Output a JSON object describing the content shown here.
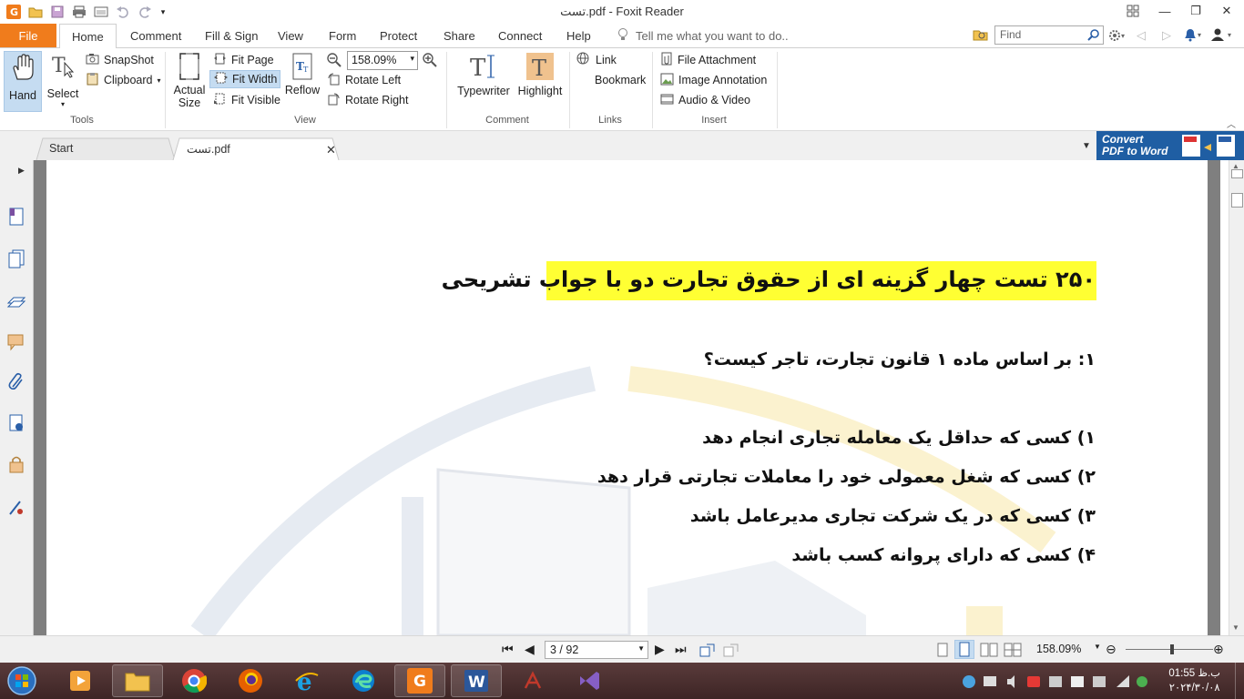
{
  "window": {
    "title": ".تست.pdf - Foxit Reader",
    "title_display": "تست.pdf - Foxit Reader"
  },
  "menu": {
    "file": "File",
    "tabs": [
      "Home",
      "Comment",
      "Fill & Sign",
      "View",
      "Form",
      "Protect",
      "Share",
      "Connect",
      "Help"
    ],
    "tell_me": "Tell me what you want to do..",
    "find_placeholder": "Find"
  },
  "ribbon": {
    "tools": {
      "hand": "Hand",
      "select": "Select",
      "snapshot": "SnapShot",
      "clipboard": "Clipboard",
      "label": "Tools"
    },
    "view": {
      "actual_size_1": "Actual",
      "actual_size_2": "Size",
      "fit_page": "Fit Page",
      "fit_width": "Fit Width",
      "fit_visible": "Fit Visible",
      "reflow": "Reflow",
      "zoom": "158.09%",
      "rotate_left": "Rotate Left",
      "rotate_right": "Rotate Right",
      "label": "View"
    },
    "comment": {
      "typewriter": "Typewriter",
      "highlight": "Highlight",
      "label": "Comment"
    },
    "links": {
      "link": "Link",
      "bookmark": "Bookmark",
      "label": "Links"
    },
    "insert": {
      "file_attachment": "File Attachment",
      "image_annotation": "Image Annotation",
      "audio_video": "Audio & Video",
      "label": "Insert"
    }
  },
  "doc_tabs": {
    "start": "Start",
    "current": "تست.pdf"
  },
  "convert_banner": {
    "line1": "Convert",
    "line2": "PDF to Word"
  },
  "document": {
    "heading": "۲۵۰ تست چهار گزینه ای از حقوق تجارت دو با جواب تشریحی",
    "question": "۱: بر اساس ماده ۱ قانون تجارت، تاجر کیست؟",
    "options": [
      "۱) کسی که حداقل یک معامله تجاری انجام دهد",
      "۲) کسی که شغل معمولی خود را معاملات تجارتی قرار دهد",
      "۳) کسی که در یک شرکت تجاری مدیرعامل باشد",
      "۴) کسی که دارای پروانه کسب باشد"
    ],
    "highlight_color": "#ffff33"
  },
  "status": {
    "page": "3 / 92",
    "zoom": "158.09%"
  },
  "taskbar": {
    "time": "01:55 ب.ظ",
    "date": "۲۰۲۴/۳۰/۰۸"
  },
  "colors": {
    "accent": "#f07c1c",
    "banner": "#1f5ea3",
    "taskbar": "#4a2f2f"
  }
}
